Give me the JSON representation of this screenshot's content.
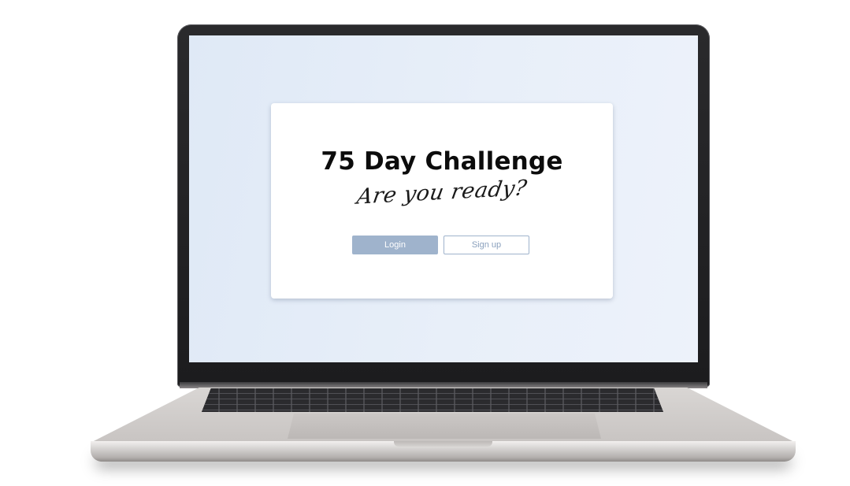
{
  "hero": {
    "title": "75 Day Challenge",
    "tagline": "Are you ready?"
  },
  "actions": {
    "login_label": "Login",
    "signup_label": "Sign up"
  },
  "colors": {
    "screen_background": "#e4ecf7",
    "card_background": "#ffffff",
    "accent": "#9fb3cc",
    "title_text": "#0c0c0c"
  }
}
